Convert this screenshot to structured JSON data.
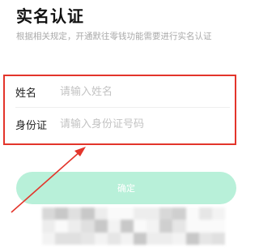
{
  "page": {
    "title": "实名认证",
    "subtitle": "根据相关规定，开通默往零钱功能需要进行实名认证"
  },
  "form": {
    "name_label": "姓名",
    "name_placeholder": "请输入姓名",
    "id_label": "身份证",
    "id_placeholder": "请输入身份证号码"
  },
  "confirm_button": {
    "label": "确定"
  },
  "colors": {
    "highlight_border": "#e3352b",
    "arrow": "#e3352b",
    "button_bg": "#b8f0d9",
    "subtitle_text": "#a9a9a9",
    "placeholder_text": "#c3c3c3"
  }
}
